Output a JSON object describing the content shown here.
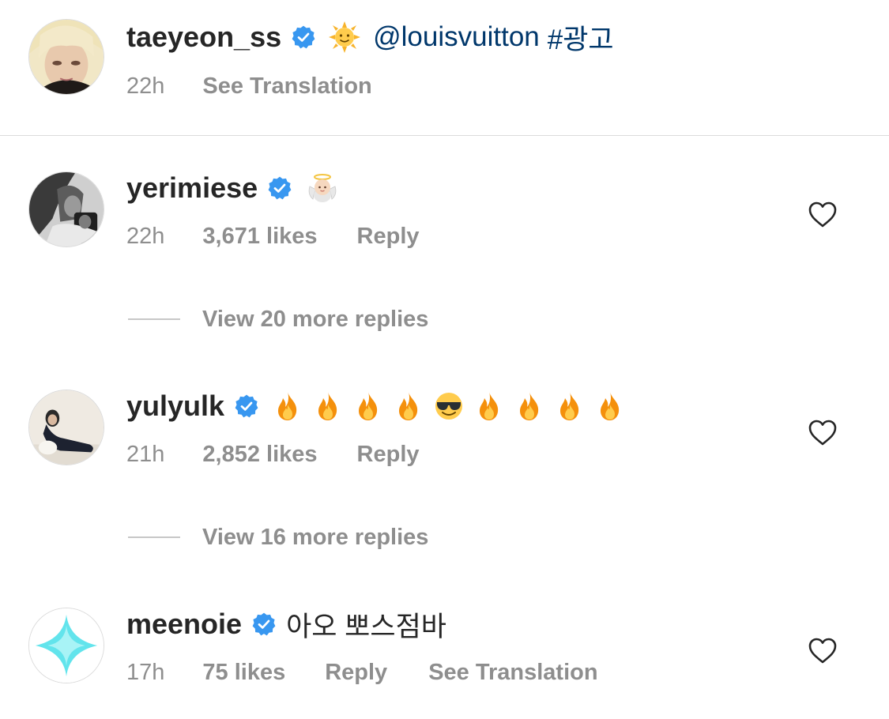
{
  "caption": {
    "username": "taeyeon_ss",
    "verified": true,
    "emoji": "sun-with-face",
    "mention": "@louisvuitton",
    "hashtag": "#광고",
    "time": "22h",
    "see_translation": "See Translation"
  },
  "comments": [
    {
      "username": "yerimiese",
      "verified": true,
      "text": "👼🏻",
      "emoji": "baby-angel",
      "time": "22h",
      "likes": "3,671 likes",
      "reply": "Reply",
      "view_replies": "View 20 more replies"
    },
    {
      "username": "yulyulk",
      "verified": true,
      "text": "🔥🔥🔥🔥😎🔥🔥🔥🔥",
      "emojis": [
        "fire",
        "fire",
        "fire",
        "fire",
        "smiling-face-with-sunglasses",
        "fire",
        "fire",
        "fire",
        "fire"
      ],
      "time": "21h",
      "likes": "2,852 likes",
      "reply": "Reply",
      "view_replies": "View 16 more replies"
    },
    {
      "username": "meenoie",
      "verified": true,
      "text": "아오 뽀스점바",
      "time": "17h",
      "likes": "75 likes",
      "reply": "Reply",
      "see_translation": "See Translation"
    }
  ],
  "colors": {
    "text": "#262626",
    "muted": "#8e8e8e",
    "link": "#00376b",
    "verified_badge": "#3897f0",
    "divider": "#dbdbdb"
  },
  "icons": {
    "verified": "verified-badge-icon",
    "like": "heart-outline-icon"
  }
}
